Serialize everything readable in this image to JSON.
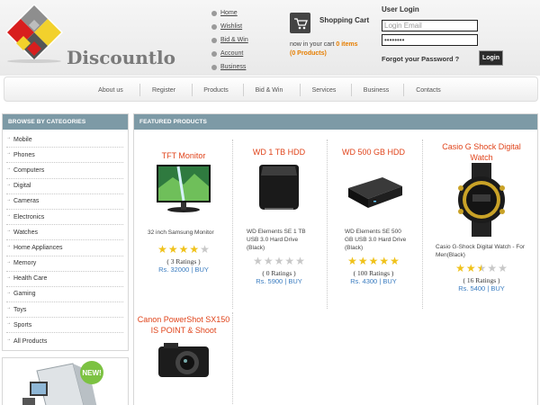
{
  "site": {
    "name": "Discountlo"
  },
  "top_links": [
    "Home",
    "Wishlist",
    "Bid & Win",
    "Account",
    "Business"
  ],
  "cart": {
    "title": "Shopping Cart",
    "prefix": "now in your cart",
    "items": "0 items",
    "products": "(0 Products)"
  },
  "login": {
    "title": "User Login",
    "email_placeholder": "Login Email",
    "password_value": "••••••••",
    "forgot": "Forgot your Password ?",
    "button": "Login"
  },
  "nav": [
    "About us",
    "Register",
    "Products",
    "Bid & Win",
    "Services",
    "Business",
    "Contacts"
  ],
  "sidebar": {
    "heading": "BROWSE BY CATEGORIES",
    "categories": [
      "Mobile",
      "Phones",
      "Computers",
      "Digital",
      "Cameras",
      "Electronics",
      "Watches",
      "Home Appliances",
      "Memory",
      "Health Care",
      "Gaming",
      "Toys",
      "Sports",
      "All Products"
    ]
  },
  "promo": {
    "badge": "NEW!"
  },
  "featured": {
    "heading": "FEATURED PRODUCTS",
    "products": [
      {
        "title": "TFT Monitor",
        "desc": "32 inch Samsung Monitor",
        "stars": 4,
        "ratings": "( 3 Ratings )",
        "price": "Rs. 32000",
        "buy": "BUY",
        "icon": "monitor-image"
      },
      {
        "title": "WD 1 TB HDD",
        "desc": "WD Elements SE 1 TB USB 3.0 Hard Drive (Black)",
        "stars": 0,
        "ratings": "( 0 Ratings )",
        "price": "Rs. 5900",
        "buy": "BUY",
        "icon": "hdd-image"
      },
      {
        "title": "WD 500 GB HDD",
        "desc": "WD Elements SE 500 GB USB 3.0 Hard Drive (Black)",
        "stars": 5,
        "ratings": "( 100 Ratings )",
        "price": "Rs. 4300",
        "buy": "BUY",
        "icon": "hdd-image"
      },
      {
        "title": "Casio G Shock Digital Watch",
        "desc": "Casio G-Shock Digital Watch - For Men(Black)",
        "stars": 2.5,
        "ratings": "( 16 Ratings )",
        "price": "Rs. 5400",
        "buy": "BUY",
        "icon": "watch-image"
      },
      {
        "title": "Canon PowerShot SX150 IS POINT & Shoot",
        "icon": "camera-image"
      }
    ]
  }
}
